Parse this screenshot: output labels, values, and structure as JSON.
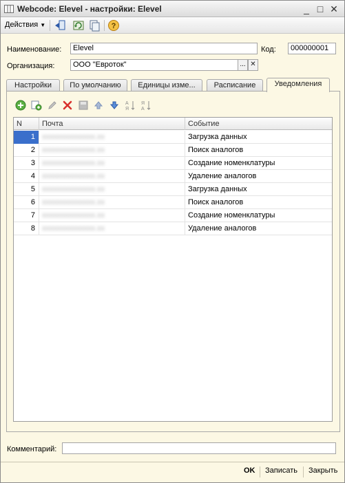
{
  "window": {
    "title": "Webcode: Elevel - настройки: Elevel"
  },
  "toolbar": {
    "actions_label": "Действия"
  },
  "form": {
    "name_label": "Наименование:",
    "name_value": "Elevel",
    "code_label": "Код:",
    "code_value": "000000001",
    "org_label": "Организация:",
    "org_value": "ООО \"Евроток\"",
    "org_select_symbol": "...",
    "org_clear_symbol": "✕"
  },
  "tabs": [
    {
      "label": "Настройки"
    },
    {
      "label": "По умолчанию"
    },
    {
      "label": "Единицы изме..."
    },
    {
      "label": "Расписание"
    },
    {
      "label": "Уведомления"
    }
  ],
  "grid": {
    "columns": [
      "N",
      "Почта",
      "Событие"
    ],
    "rows": [
      {
        "n": "1",
        "mail": "xxxxxxxxxxxxxx.xx",
        "event": "Загрузка данных"
      },
      {
        "n": "2",
        "mail": "xxxxxxxxxxxxxx.xx",
        "event": "Поиск аналогов"
      },
      {
        "n": "3",
        "mail": "xxxxxxxxxxxxxx.xx",
        "event": "Создание номенклатуры"
      },
      {
        "n": "4",
        "mail": "xxxxxxxxxxxxxx.xx",
        "event": "Удаление аналогов"
      },
      {
        "n": "5",
        "mail": "xxxxxxxxxxxxxx.xx",
        "event": "Загрузка данных"
      },
      {
        "n": "6",
        "mail": "xxxxxxxxxxxxxx.xx",
        "event": "Поиск аналогов"
      },
      {
        "n": "7",
        "mail": "xxxxxxxxxxxxxx.xx",
        "event": "Создание номенклатуры"
      },
      {
        "n": "8",
        "mail": "xxxxxxxxxxxxxx.xx",
        "event": "Удаление аналогов"
      }
    ]
  },
  "comment": {
    "label": "Комментарий:",
    "value": ""
  },
  "footer": {
    "ok_label": "OK",
    "save_label": "Записать",
    "close_label": "Закрыть"
  },
  "icons": {
    "title": "table-icon",
    "toolbar": [
      "back-icon",
      "refresh-icon",
      "copy-icon",
      "help-icon"
    ],
    "grid_toolbar": [
      "add-icon",
      "copy-row-icon",
      "edit-icon",
      "delete-icon",
      "save-icon",
      "move-up-icon",
      "move-down-icon",
      "sort-asc-icon",
      "sort-desc-icon"
    ]
  }
}
